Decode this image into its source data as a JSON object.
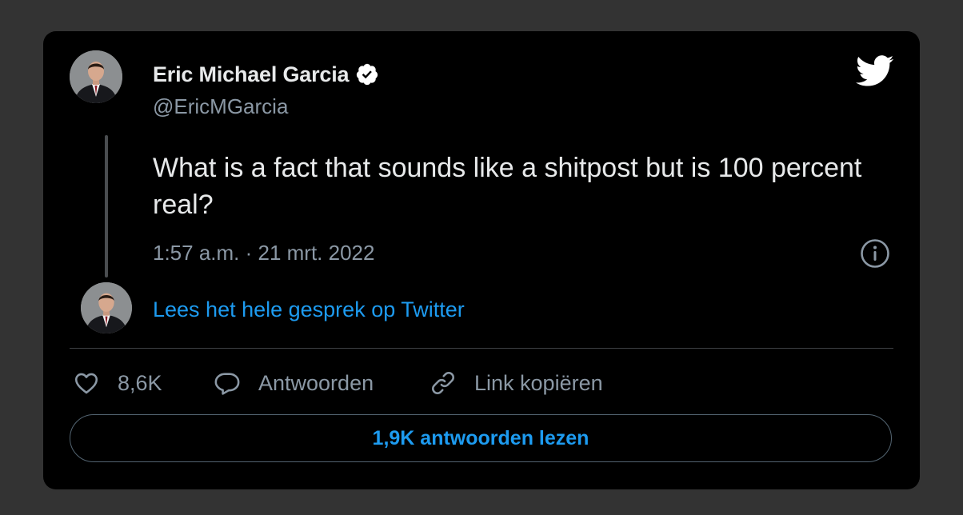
{
  "author": {
    "name": "Eric Michael Garcia",
    "handle": "@EricMGarcia",
    "verified": true,
    "avatar_icon": "person-in-suit-avatar"
  },
  "tweet": {
    "text": "What is a fact that sounds like a shitpost but is 100 percent real?",
    "timestamp": "1:57 a.m. · 21 mrt. 2022"
  },
  "conversation_link": "Lees het hele gesprek op Twitter",
  "actions": {
    "like_count": "8,6K",
    "reply_label": "Antwoorden",
    "copy_link_label": "Link kopiëren"
  },
  "read_replies_label": "1,9K antwoorden lezen",
  "icons": {
    "brand": "twitter-bird-icon",
    "verified": "verified-badge-icon",
    "info": "info-icon",
    "like": "heart-icon",
    "reply": "speech-bubble-icon",
    "copy": "link-icon"
  },
  "colors": {
    "background": "#000000",
    "text_primary": "#e7e9ea",
    "text_secondary": "#8b98a5",
    "accent": "#1d9bf0"
  }
}
